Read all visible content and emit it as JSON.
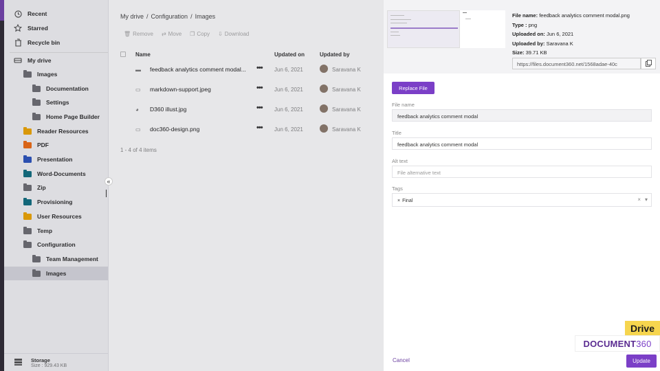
{
  "sidebar": {
    "nav": [
      {
        "label": "Recent",
        "icon": "clock-icon"
      },
      {
        "label": "Starred",
        "icon": "star-icon"
      },
      {
        "label": "Recycle bin",
        "icon": "trash-icon"
      },
      {
        "label": "My drive",
        "icon": "drive-icon"
      }
    ],
    "folders": [
      {
        "label": "Images",
        "color": "#6d6d72",
        "indent": 1
      },
      {
        "label": "Documentation",
        "color": "#6d6d72",
        "indent": 2
      },
      {
        "label": "Settings",
        "color": "#6d6d72",
        "indent": 2
      },
      {
        "label": "Home Page Builder",
        "color": "#6d6d72",
        "indent": 2
      },
      {
        "label": "Reader Resources",
        "color": "#f0a500",
        "indent": 1
      },
      {
        "label": "PDF",
        "color": "#f06a10",
        "indent": 1
      },
      {
        "label": "Presentation",
        "color": "#2a52be",
        "indent": 1
      },
      {
        "label": "Word-Documents",
        "color": "#0e6e80",
        "indent": 1
      },
      {
        "label": "Zip",
        "color": "#6d6d72",
        "indent": 1
      },
      {
        "label": "Provisioning",
        "color": "#0e6e80",
        "indent": 1
      },
      {
        "label": "User Resources",
        "color": "#f0a500",
        "indent": 1
      },
      {
        "label": "Temp",
        "color": "#6d6d72",
        "indent": 1
      },
      {
        "label": "Configuration",
        "color": "#6d6d72",
        "indent": 1
      },
      {
        "label": "Team Management",
        "color": "#6d6d72",
        "indent": 2
      },
      {
        "label": "Images",
        "color": "#6d6d72",
        "indent": 2,
        "active": true
      }
    ],
    "storage_title": "Storage",
    "storage_size": "Size : 929.43 KB"
  },
  "main": {
    "breadcrumb": [
      "My drive",
      "/",
      "Configuration",
      "/",
      "Images"
    ],
    "toolbar": {
      "remove": "Remove",
      "move": "Move",
      "copy": "Copy",
      "download": "Download"
    },
    "columns": {
      "name": "Name",
      "updated_on": "Updated on",
      "updated_by": "Updated by"
    },
    "files": [
      {
        "name": "feedback analytics comment modal...",
        "date": "Jun 6, 2021",
        "user": "Saravana K"
      },
      {
        "name": "markdown-support.jpeg",
        "date": "Jun 6, 2021",
        "user": "Saravana K"
      },
      {
        "name": "D360 illust.jpg",
        "date": "Jun 6, 2021",
        "user": "Saravana K"
      },
      {
        "name": "doc360-design.png",
        "date": "Jun 6, 2021",
        "user": "Saravana K"
      }
    ],
    "pager": "1 - 4 of 4 items"
  },
  "panel": {
    "meta": {
      "file_name_label": "File name:",
      "file_name": "feedback analytics comment modal.png",
      "type_label": "Type :",
      "type": "png",
      "uploaded_on_label": "Uploaded on:",
      "uploaded_on": "Jun 6, 2021",
      "uploaded_by_label": "Uploaded by:",
      "uploaded_by": "Saravana K",
      "size_label": "Size:",
      "size": "39.71 KB"
    },
    "url": "https://files.document360.net/1568adae-40c",
    "replace_label": "Replace File",
    "file_name_field_label": "File name",
    "file_name_value": "feedback analytics comment modal",
    "title_label": "Title",
    "title_value": "feedback analytics comment modal",
    "alt_label": "Alt text",
    "alt_placeholder": "File alternative text",
    "tags_label": "Tags",
    "tags": [
      "Final"
    ],
    "cancel_label": "Cancel",
    "update_label": "Update"
  },
  "watermark": {
    "drive": "Drive",
    "logo_text": "DOCUMENT",
    "logo_num": "360"
  }
}
